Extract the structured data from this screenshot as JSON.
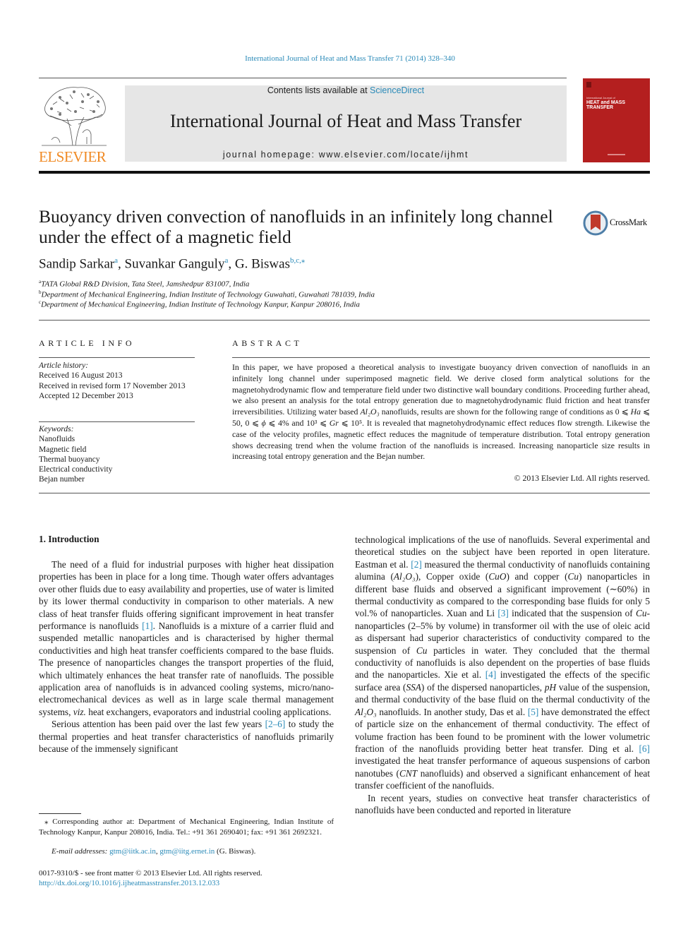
{
  "header": {
    "citation": "International Journal of Heat and Mass Transfer 71 (2014) 328–340",
    "contents_prefix": "Contents lists available at ",
    "contents_link": "ScienceDirect",
    "journal_name": "International Journal of Heat and Mass Transfer",
    "homepage_prefix": "journal homepage: ",
    "homepage_url": "www.elsevier.com/locate/ijhmt",
    "publisher_logo_text": "ELSEVIER",
    "cover": {
      "small_title": "International Journal of",
      "title_line1": "HEAT and MASS",
      "title_line2": "TRANSFER"
    }
  },
  "article": {
    "title": "Buoyancy driven convection of nanofluids in an infinitely long channel under the effect of a magnetic field",
    "crossmark_label": "CrossMark",
    "authors": [
      {
        "name": "Sandip Sarkar",
        "sup": "a"
      },
      {
        "name": "Suvankar Ganguly",
        "sup": "a"
      },
      {
        "name": "G. Biswas",
        "sup": "b,c,⁎"
      }
    ],
    "affiliations": [
      {
        "key": "a",
        "text": "TATA Global R&D Division, Tata Steel, Jamshedpur 831007, India"
      },
      {
        "key": "b",
        "text": "Department of Mechanical Engineering, Indian Institute of Technology Guwahati, Guwahati 781039, India"
      },
      {
        "key": "c",
        "text": "Department of Mechanical Engineering, Indian Institute of Technology Kanpur, Kanpur 208016, India"
      }
    ]
  },
  "article_info": {
    "heading": "ARTICLE INFO",
    "history_label": "Article history:",
    "history": [
      "Received 16 August 2013",
      "Received in revised form 17 November 2013",
      "Accepted 12 December 2013"
    ],
    "keywords_label": "Keywords:",
    "keywords": [
      "Nanofluids",
      "Magnetic field",
      "Thermal buoyancy",
      "Electrical conductivity",
      "Bejan number"
    ]
  },
  "abstract": {
    "heading": "ABSTRACT",
    "text_part1": "In this paper, we have proposed a theoretical analysis to investigate buoyancy driven convection of nanofluids in an infinitely long channel under superimposed magnetic field. We derive closed form analytical solutions for the magnetohydrodynamic flow and temperature field under two distinctive wall boundary conditions. Proceeding further ahead, we also present an analysis for the total entropy generation due to magnetohydrodynamic fluid friction and heat transfer irreversibilities. Utilizing water based ",
    "al2o3": "Al₂O₃",
    "text_part2": " nanofluids, results are shown for the following range of conditions as 0 ⩽ ",
    "ha": "Ha",
    "text_part3": " ⩽ 50, 0 ⩽ ",
    "phi": "ϕ",
    "text_part4": " ⩽ 4% and 10³ ⩽ ",
    "gr": "Gr",
    "text_part5": " ⩽ 10⁵. It is revealed that magnetohydrodynamic effect reduces flow strength. Likewise the case of the velocity profiles, magnetic effect reduces the magnitude of temperature distribution. Total entropy generation shows decreasing trend when the volume fraction of the nanofluids is increased. Increasing nanoparticle size results in increasing total entropy generation and the Bejan number.",
    "copyright": "© 2013 Elsevier Ltd. All rights reserved."
  },
  "introduction": {
    "heading": "1. Introduction",
    "left_p1_a": "The need of a fluid for industrial purposes with higher heat dissipation properties has been in place for a long time. Though water offers advantages over other fluids due to easy availability and properties, use of water is limited by its lower thermal conductivity in comparison to other materials. A new class of heat transfer fluids offering significant improvement in heat transfer performance is nanofluids ",
    "ref1": "[1]",
    "left_p1_b": ". Nanofluids is a mixture of a carrier fluid and suspended metallic nanoparticles and is characterised by higher thermal conductivities and high heat transfer coefficients compared to the base fluids. The presence of nanoparticles changes the transport properties of the fluid, which ultimately enhances the heat transfer rate of nanofluids. The possible application area of nanofluids is in advanced cooling systems, micro/nano-electromechanical devices as well as in large scale thermal management systems, ",
    "viz": "viz.",
    "left_p1_c": " heat exchangers, evaporators and industrial cooling applications.",
    "left_p2_a": "Serious attention has been paid over the last few years ",
    "ref2_6": "[2–6]",
    "left_p2_b": " to study the thermal properties and heat transfer characteristics of nanofluids primarily because of the immensely significant",
    "right_p1_a": "technological implications of the use of nanofluids. Several experimental and theoretical studies on the subject have been reported in open literature. Eastman et al. ",
    "ref2": "[2]",
    "right_p1_b": " measured the thermal conductivity of nanofluids containing alumina (",
    "al2o3": "Al₂O₃",
    "right_p1_c": "), Copper oxide (",
    "cuo": "CuO",
    "right_p1_d": ") and copper (",
    "cu": "Cu",
    "right_p1_e": ") nanoparticles in different base fluids and observed a significant improvement (∼60%) in thermal conductivity as compared to the corresponding base fluids for only 5 vol.% of nanoparticles. Xuan and Li ",
    "ref3": "[3]",
    "right_p1_f": " indicated that the suspension of ",
    "right_p1_g": "-nanoparticles (2–5% by volume) in transformer oil with the use of oleic acid as dispersant had superior characteristics of conductivity compared to the suspension of ",
    "right_p1_h": " particles in water. They concluded that the thermal conductivity of nanofluids is also dependent on the properties of base fluids and the nanoparticles. Xie et al. ",
    "ref4": "[4]",
    "right_p1_i": " investigated the effects of the specific surface area (",
    "ssa": "SSA",
    "right_p1_j": ") of the dispersed nanoparticles, ",
    "ph": "pH",
    "right_p1_k": " value of the suspension, and thermal conductivity of the base fluid on the thermal conductivity of the ",
    "right_p1_l": " nanofluids. In another study, Das et al. ",
    "ref5": "[5]",
    "right_p1_m": " have demonstrated the effect of particle size on the enhancement of thermal conductivity. The effect of volume fraction has been found to be prominent with the lower volumetric fraction of the nanofluids providing better heat transfer. Ding et al. ",
    "ref6": "[6]",
    "right_p1_n": " investigated the heat transfer performance of aqueous suspensions of carbon nanotubes (",
    "cnt": "CNT",
    "right_p1_o": " nanofluids) and observed a significant enhancement of heat transfer coefficient of the nanofluids.",
    "right_p2": "In recent years, studies on convective heat transfer characteristics of nanofluids have been conducted and reported in literature"
  },
  "footnotes": {
    "corresponding": "⁎ Corresponding author at: Department of Mechanical Engineering, Indian Institute of Technology Kanpur, Kanpur 208016, India. Tel.: +91 361 2690401; fax: +91 361 2692321.",
    "email_label": "E-mail addresses:",
    "email1": "gtm@iitk.ac.in",
    "email2": "gtm@iitg.ernet.in",
    "email_owner": " (G. Biswas).",
    "front_matter": "0017-9310/$ - see front matter © 2013 Elsevier Ltd. All rights reserved.",
    "doi": "http://dx.doi.org/10.1016/j.ijheatmasstransfer.2013.12.033"
  },
  "colors": {
    "link": "#2a8ab8",
    "elsevier_orange": "#f08a24",
    "cover_red": "#b41f1f",
    "masthead_gray": "#e6e6e6"
  }
}
